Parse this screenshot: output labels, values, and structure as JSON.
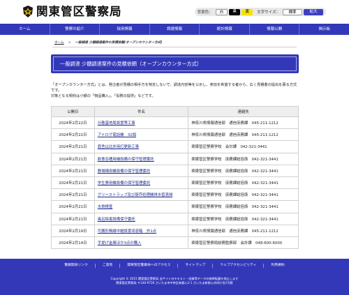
{
  "site": {
    "title": "関東管区警察局"
  },
  "tools": {
    "bg_label": "背景色：",
    "bg_white": "白",
    "bg_black": "黒",
    "bg_yellow": "黄",
    "font_label": "文字サイズ：",
    "font_standard": "標準",
    "font_large": "拡大"
  },
  "nav": [
    {
      "label": "ホーム"
    },
    {
      "label": "警察の紹介"
    },
    {
      "label": "採用情報"
    },
    {
      "label": "調達情報"
    },
    {
      "label": "統計情報"
    },
    {
      "label": "情報公開"
    },
    {
      "label": "掲示板"
    }
  ],
  "breadcrumb": {
    "home": "ホーム",
    "sep": ">",
    "current": "一般調達 少額調達案件の見積依頼(オープンカウンター方式)"
  },
  "page_title": "一般調達 少額調達案件の見積依頼（オープンカウンター方式）",
  "intro": {
    "line1": "「オープンカウンター方式」とは、発注者が見積の相手方を特定しないで、調達内容等を公示し、参加を希望する者から、広く見積書の提出を募る方式です。",
    "line2": "対象となる契約は小額の「物品購入」、「役務の提供」などです。"
  },
  "table": {
    "headers": {
      "date": "公開日",
      "subject": "件名",
      "contact": "連絡先"
    },
    "rows": [
      {
        "date": "2024年2月22日",
        "subject": "分散基地局設置等工事",
        "contact": "神奈川県情報通信部　通信庶務課　045-211-1212"
      },
      {
        "date": "2024年2月22日",
        "subject": "アナログ電話機　32個",
        "contact": "神奈川県情報通信部　通信庶務課　045-211-1212"
      },
      {
        "date": "2024年2月21日",
        "subject": "庭舎は北井用灯更新工事",
        "contact": "関東管区警察学校　会計課　042-321-3441"
      },
      {
        "date": "2024年2月21日",
        "subject": "飲食浴槽用機設備の保守管理委託",
        "contact": "関東管区警察学校　庶務課総括係　042-321-3441"
      },
      {
        "date": "2024年2月21日",
        "subject": "教場棟用機設備の保守管理委託",
        "contact": "関東管区警察学校　庶務課総括係　042-321-3441"
      },
      {
        "date": "2024年2月21日",
        "subject": "学生寮用機設備の保守管理委託",
        "contact": "関東管区警察学校　庶務課総括係　042-321-3441"
      },
      {
        "date": "2024年2月21日",
        "subject": "グリーストラップ及び厨芥処理機排水管清掃",
        "contact": "関東管区警察学校　庶務課総括係　042-321-3441"
      },
      {
        "date": "2024年2月21日",
        "subject": "水質検査",
        "contact": "関東管区警察学校　庶務課総括係　042-321-3441"
      },
      {
        "date": "2024年2月21日",
        "subject": "風呂除害設備保守委託",
        "contact": "関東管区警察学校　庶務課総括係　042-321-3441"
      },
      {
        "date": "2024年2月19日",
        "subject": "可搬形無線中継設置収容箱　外1点",
        "contact": "神奈川県情報通信部　通信庶務課　045-211-1212"
      },
      {
        "date": "2024年2月14日",
        "subject": "手提げ金庫ほか3点の購入",
        "contact": "関東管区警察局総務監察部　会計課　048-600-6000"
      }
    ]
  },
  "footer": {
    "links": [
      {
        "label": "警察関係リンク"
      },
      {
        "label": "ご意見"
      },
      {
        "label": "関東管区警察局へのアクセス"
      },
      {
        "label": "サイトマップ"
      },
      {
        "label": "ウェブアクセシビリティ"
      },
      {
        "label": "利用規約"
      }
    ],
    "copyright": "Copyright © 2015 関東管区警察局 当サイトのテキスト・画像等データの無断転載を禁止します",
    "address": "関東管区警察局 〒330-9726 さいたま市中央区新都心2-1 さいたま新都心合同庁舎2号館"
  },
  "colors": {
    "brand": "#3238b8",
    "link": "#1d2a8f"
  }
}
